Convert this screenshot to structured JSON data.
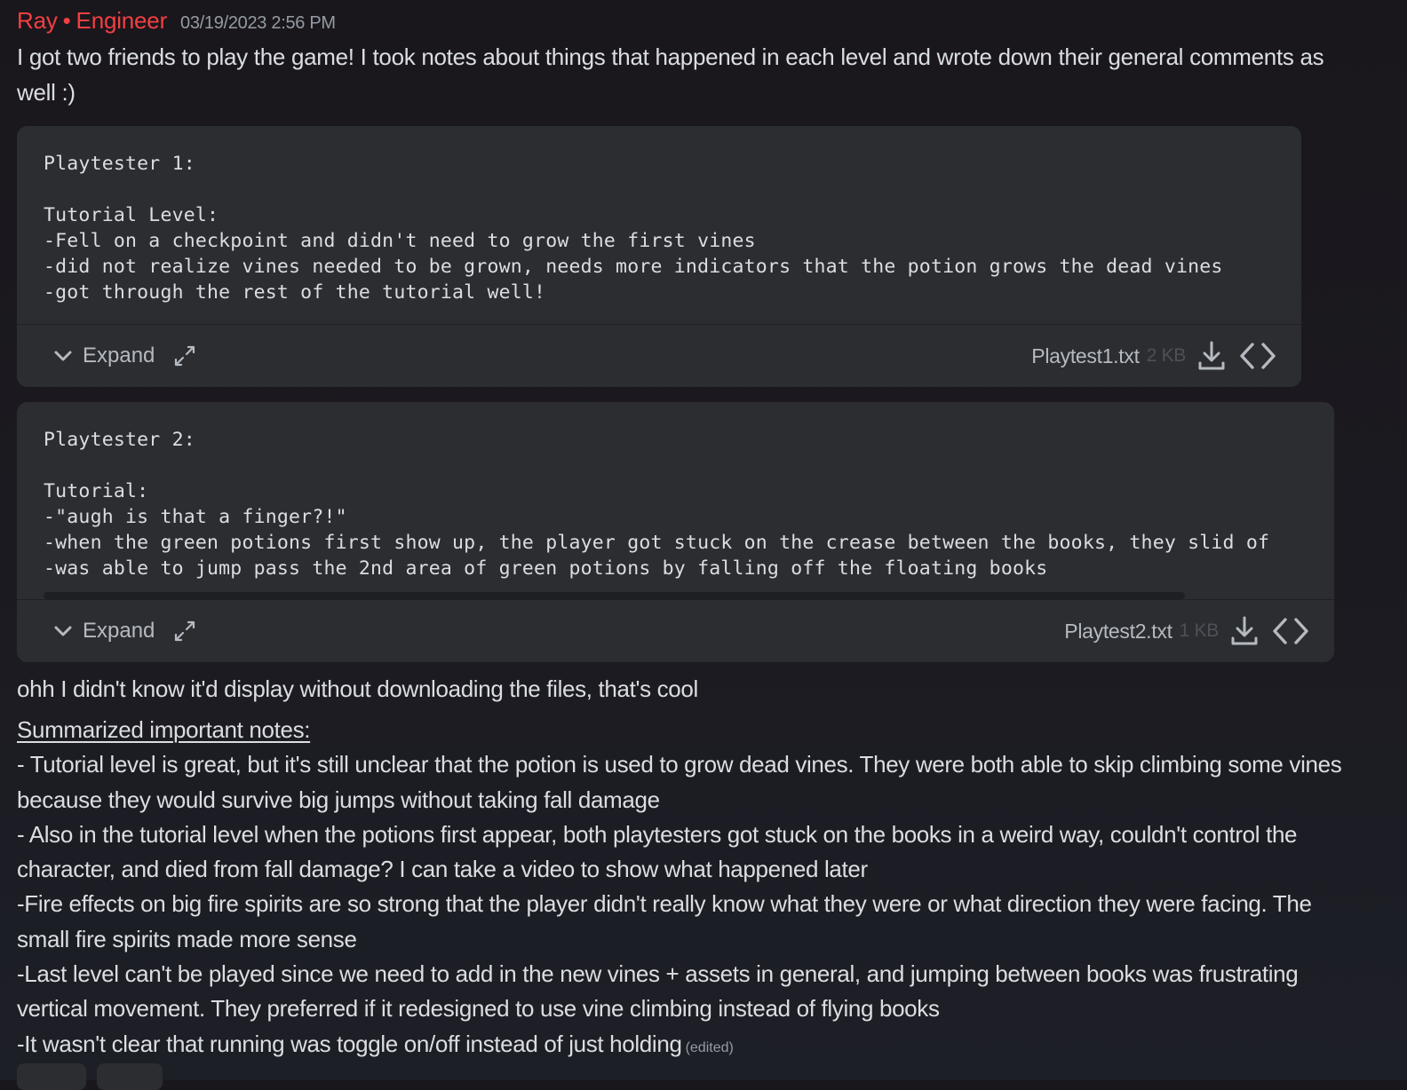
{
  "message": {
    "author": "Ray",
    "role": "Engineer",
    "separator": "•",
    "timestamp": "03/19/2023 2:56 PM",
    "author_color": "#f23f43",
    "intro": "I got two friends to play the game! I took notes about things that happened in each level and wrote down their general comments as well :)"
  },
  "attachments": [
    {
      "content_lines": [
        "Playtester 1:",
        "",
        "Tutorial Level:",
        "-Fell on a checkpoint and didn't need to grow the first vines",
        "-did not realize vines needed to be grown, needs more indicators that the potion grows the dead vines",
        "-got through the rest of the tutorial well!"
      ],
      "expand_label": "Expand",
      "file_name": "Playtest1.txt",
      "file_size": "2 KB"
    },
    {
      "content_lines": [
        "Playtester 2:",
        "",
        "Tutorial:",
        "-\"augh is that a finger?!\"",
        "-when the green potions first show up, the player got stuck on the crease between the books, they slid of",
        "-was able to jump pass the 2nd area of green potions by falling off the floating books"
      ],
      "expand_label": "Expand",
      "file_name": "Playtest2.txt",
      "file_size": "1 KB"
    }
  ],
  "followup": "ohh I didn't know it'd display without downloading the files, that's cool",
  "summary": {
    "heading": "Summarized important notes:",
    "items": [
      "- Tutorial level is great, but it's still unclear that the potion is used to grow dead vines. They were both able to skip climbing some vines because they would survive big jumps without taking fall damage",
      "- Also in the tutorial level when the potions first appear, both playtesters got stuck on the books in a weird way, couldn't control the character, and died from fall damage? I can take a video to show what happened later",
      "-Fire effects on big fire spirits are so strong that the player didn't really know what they were or what direction they were facing. The small fire spirits made more sense",
      "-Last level can't be played since we need to add in the new vines + assets in general, and jumping between books was frustrating vertical movement. They preferred if it redesigned to use vine climbing instead of flying books",
      "-It wasn't clear that running was toggle on/off instead of just holding"
    ],
    "edited_label": "(edited)"
  },
  "icons": {
    "expand": "chevron-down-icon",
    "fullscreen": "maximize-arrows-icon",
    "download": "download-icon",
    "view_source": "code-brackets-icon"
  }
}
